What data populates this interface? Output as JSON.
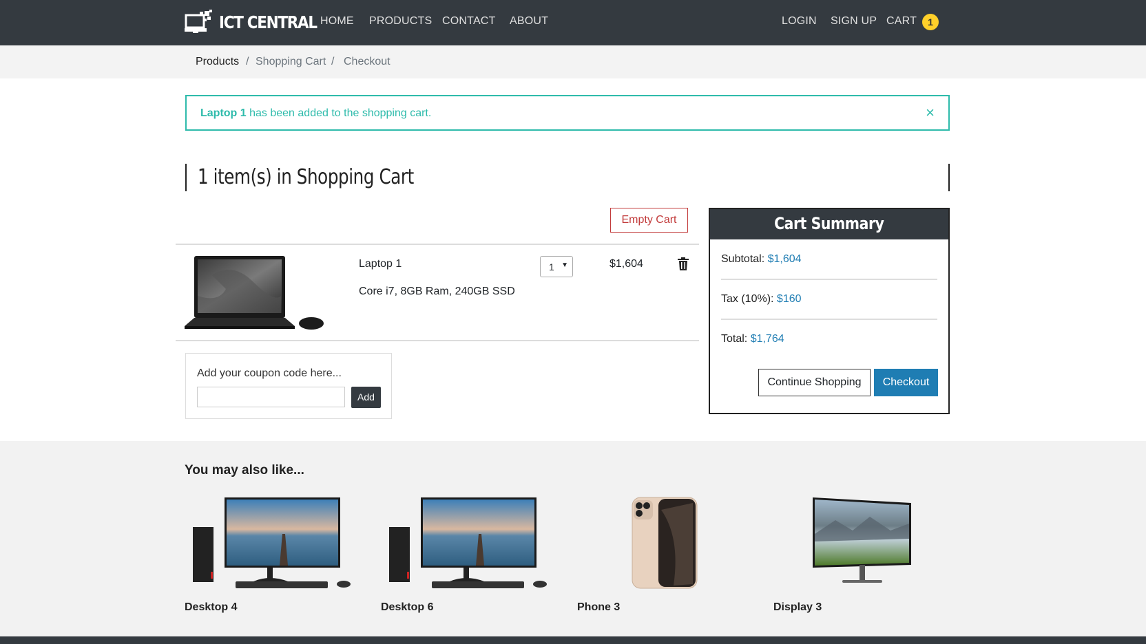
{
  "navbar": {
    "brand": "ICT CENTRAL",
    "links": [
      "HOME",
      "PRODUCTS",
      "CONTACT",
      "ABOUT"
    ],
    "right_links": [
      "LOGIN",
      "SIGN UP",
      "CART"
    ],
    "cart_count": "1"
  },
  "breadcrumb": [
    "Products",
    "Shopping Cart",
    "Checkout"
  ],
  "alert": {
    "product": "Laptop 1",
    "message": " has been added to the shopping cart.",
    "close": "×"
  },
  "heading": "1 item(s) in Shopping Cart",
  "cart": {
    "empty_label": "Empty Cart",
    "items": [
      {
        "name": "Laptop 1",
        "description": "Core i7, 8GB Ram, 240GB SSD",
        "quantity": "1",
        "price": "$1,604"
      }
    ]
  },
  "coupon": {
    "label": "Add your coupon code here...",
    "value": "",
    "add_label": "Add"
  },
  "summary": {
    "title": "Cart Summary",
    "subtotal_label": "Subtotal: ",
    "subtotal": "$1,604",
    "tax_label": "Tax (10%): ",
    "tax": "$160",
    "total_label": "Total: ",
    "total": "$1,764",
    "continue_label": "Continue Shopping",
    "checkout_label": "Checkout"
  },
  "recommendations": {
    "title": "You may also like...",
    "items": [
      {
        "name": "Desktop 4"
      },
      {
        "name": "Desktop 6"
      },
      {
        "name": "Phone 3"
      },
      {
        "name": "Display 3"
      }
    ]
  },
  "colors": {
    "nav_bg": "#343a40",
    "accent_teal": "#2ebbab",
    "link_blue": "#1f7db3",
    "danger": "#c23b3b",
    "badge": "#ffd02a"
  }
}
